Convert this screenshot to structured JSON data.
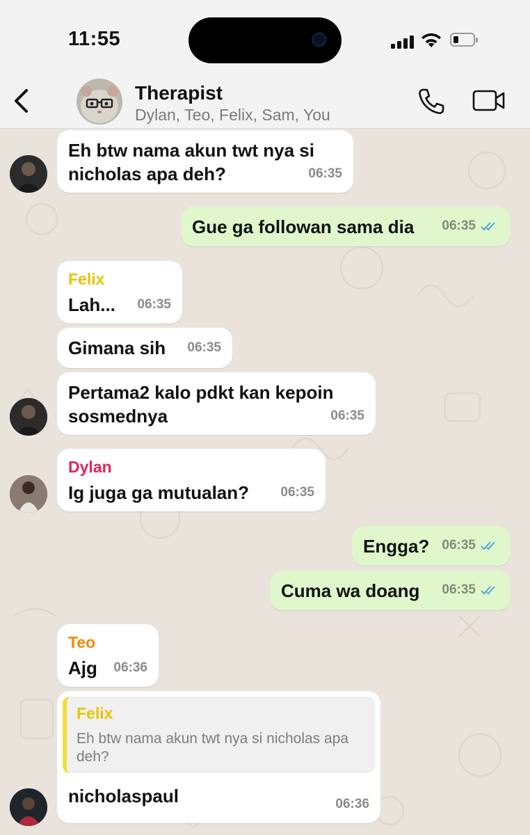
{
  "status_bar": {
    "time": "11:55"
  },
  "header": {
    "title": "Therapist",
    "members": "Dylan, Teo, Felix, Sam, You",
    "back_icon": "chevron-left-icon",
    "call_icon": "phone-icon",
    "video_icon": "video-camera-icon"
  },
  "colors": {
    "incoming_bubble": "#ffffff",
    "outgoing_bubble": "#dff7cb",
    "read_ticks": "#4fa3e0",
    "felix": "#e6c400",
    "dylan": "#e0245e",
    "teo": "#f08a00"
  },
  "messages": [
    {
      "sender": "",
      "text": "Eh btw nama akun twt nya si nicholas apa deh?",
      "time": "06:35"
    },
    {
      "sender": "You",
      "text": "Gue ga followan sama dia",
      "time": "06:35",
      "read": true
    },
    {
      "sender": "Felix",
      "text": "Lah...",
      "time": "06:35"
    },
    {
      "sender": "",
      "text": "Gimana sih",
      "time": "06:35"
    },
    {
      "sender": "",
      "text": "Pertama2 kalo pdkt kan kepoin sosmednya",
      "time": "06:35"
    },
    {
      "sender": "Dylan",
      "text": "Ig juga ga mutualan?",
      "time": "06:35"
    },
    {
      "sender": "You",
      "text": "Engga?",
      "time": "06:35",
      "read": true
    },
    {
      "sender": "You",
      "text": "Cuma wa doang",
      "time": "06:35",
      "read": true
    },
    {
      "sender": "Teo",
      "text": "Ajg",
      "time": "06:36"
    },
    {
      "sender": "",
      "quoted": {
        "name": "Felix",
        "text": "Eh btw nama akun twt nya si nicholas apa deh?"
      },
      "text": "nicholaspaul",
      "time": "06:36"
    }
  ]
}
